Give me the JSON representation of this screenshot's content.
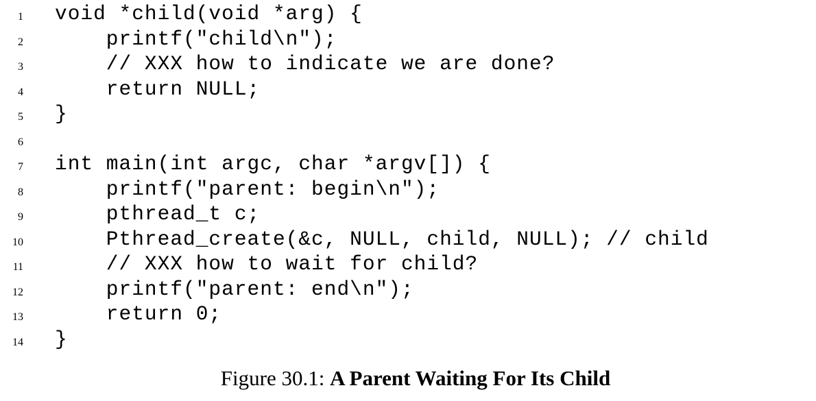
{
  "code_lines": [
    {
      "number": "1",
      "text": "void *child(void *arg) {"
    },
    {
      "number": "2",
      "text": "    printf(\"child\\n\");"
    },
    {
      "number": "3",
      "text": "    // XXX how to indicate we are done?"
    },
    {
      "number": "4",
      "text": "    return NULL;"
    },
    {
      "number": "5",
      "text": "}"
    },
    {
      "number": "6",
      "text": ""
    },
    {
      "number": "7",
      "text": "int main(int argc, char *argv[]) {"
    },
    {
      "number": "8",
      "text": "    printf(\"parent: begin\\n\");"
    },
    {
      "number": "9",
      "text": "    pthread_t c;"
    },
    {
      "number": "10",
      "text": "    Pthread_create(&c, NULL, child, NULL); // child"
    },
    {
      "number": "11",
      "text": "    // XXX how to wait for child?"
    },
    {
      "number": "12",
      "text": "    printf(\"parent: end\\n\");"
    },
    {
      "number": "13",
      "text": "    return 0;"
    },
    {
      "number": "14",
      "text": "}"
    }
  ],
  "caption": {
    "label": "Figure 30.1: ",
    "title": "A Parent Waiting For Its Child"
  }
}
